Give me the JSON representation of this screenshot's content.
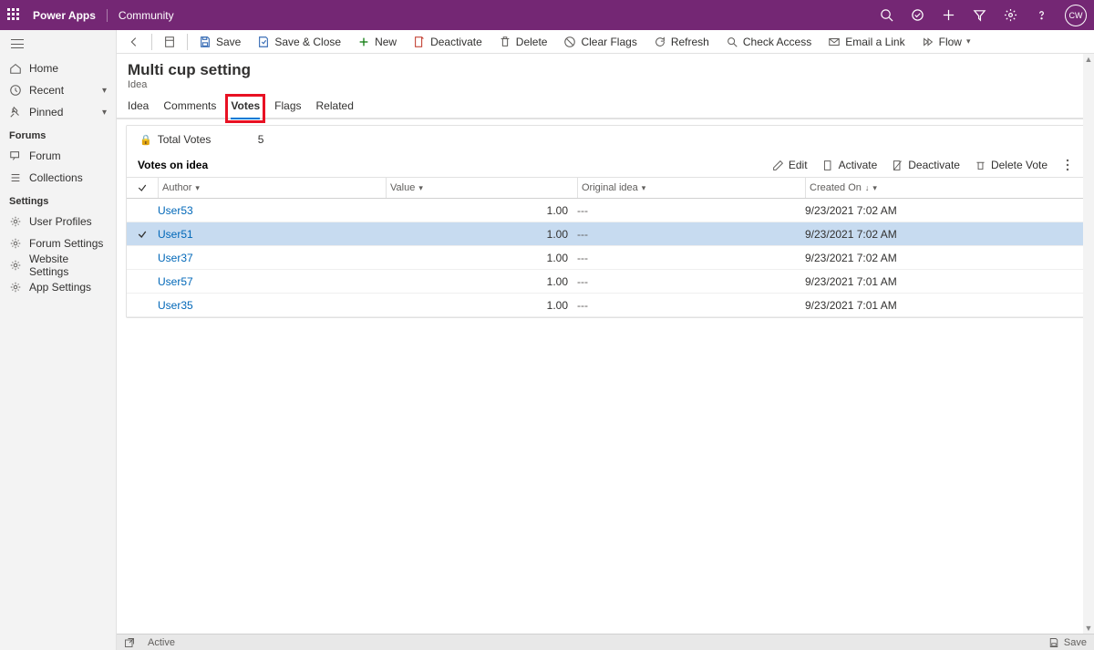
{
  "topbar": {
    "app_title": "Power Apps",
    "environment": "Community",
    "avatar_initials": "CW"
  },
  "sidebar": {
    "nav": [
      {
        "icon": "home",
        "label": "Home"
      },
      {
        "icon": "clock",
        "label": "Recent",
        "expandable": true
      },
      {
        "icon": "pin",
        "label": "Pinned",
        "expandable": true
      }
    ],
    "sections": [
      {
        "title": "Forums",
        "items": [
          {
            "icon": "forum",
            "label": "Forum"
          },
          {
            "icon": "list",
            "label": "Collections"
          }
        ]
      },
      {
        "title": "Settings",
        "items": [
          {
            "icon": "gear",
            "label": "User Profiles"
          },
          {
            "icon": "gear",
            "label": "Forum Settings"
          },
          {
            "icon": "gear",
            "label": "Website Settings"
          },
          {
            "icon": "gear",
            "label": "App Settings"
          }
        ]
      }
    ]
  },
  "commandbar": {
    "save": "Save",
    "save_close": "Save & Close",
    "new": "New",
    "deactivate": "Deactivate",
    "delete": "Delete",
    "clear_flags": "Clear Flags",
    "refresh": "Refresh",
    "check_access": "Check Access",
    "email_link": "Email a Link",
    "flow": "Flow"
  },
  "record": {
    "title": "Multi cup setting",
    "entity": "Idea"
  },
  "tabs": [
    "Idea",
    "Comments",
    "Votes",
    "Flags",
    "Related"
  ],
  "active_tab_index": 2,
  "highlighted_tab_index": 2,
  "total_votes": {
    "label": "Total Votes",
    "value": "5"
  },
  "subgrid": {
    "title": "Votes on idea",
    "actions": {
      "edit": "Edit",
      "activate": "Activate",
      "deactivate": "Deactivate",
      "delete": "Delete Vote"
    },
    "columns": {
      "author": "Author",
      "value": "Value",
      "original_idea": "Original idea",
      "created_on": "Created On"
    },
    "rows": [
      {
        "author": "User53",
        "value": "1.00",
        "original": "---",
        "created": "9/23/2021 7:02 AM",
        "selected": false
      },
      {
        "author": "User51",
        "value": "1.00",
        "original": "---",
        "created": "9/23/2021 7:02 AM",
        "selected": true
      },
      {
        "author": "User37",
        "value": "1.00",
        "original": "---",
        "created": "9/23/2021 7:02 AM",
        "selected": false
      },
      {
        "author": "User57",
        "value": "1.00",
        "original": "---",
        "created": "9/23/2021 7:01 AM",
        "selected": false
      },
      {
        "author": "User35",
        "value": "1.00",
        "original": "---",
        "created": "9/23/2021 7:01 AM",
        "selected": false
      }
    ]
  },
  "statusbar": {
    "state": "Active",
    "save": "Save"
  }
}
